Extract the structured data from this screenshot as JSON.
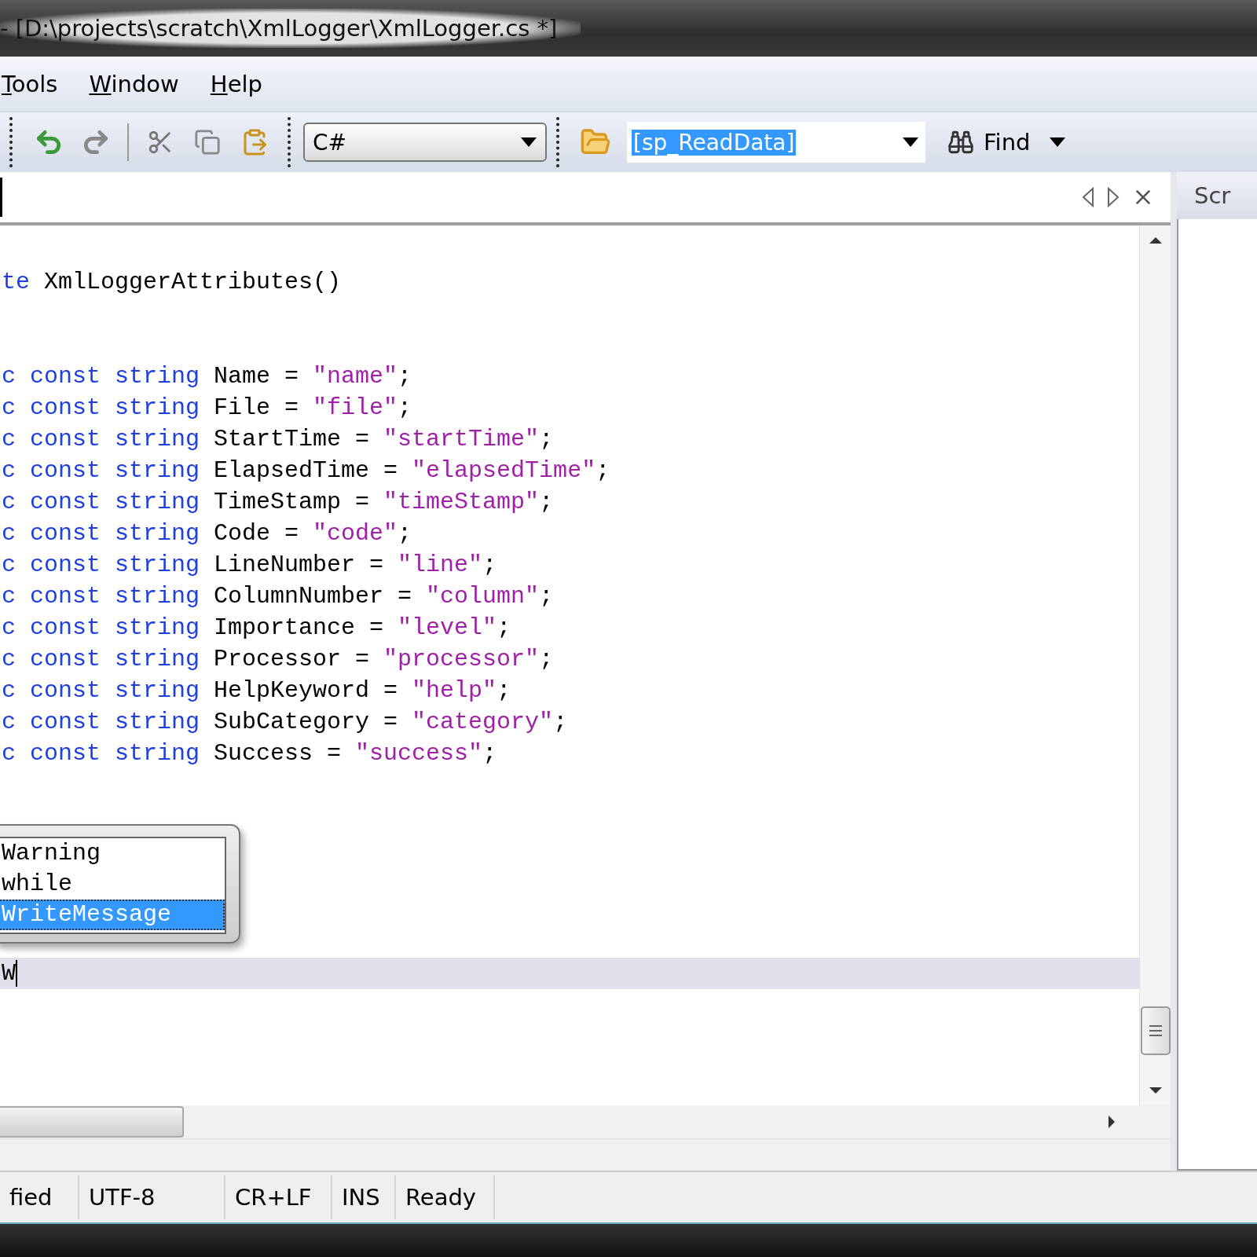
{
  "window": {
    "title": "- [D:\\projects\\scratch\\XmlLogger\\XmlLogger.cs *]"
  },
  "menu": [
    "Tools",
    "Window",
    "Help"
  ],
  "toolbar": {
    "language": "C#",
    "search": "[sp_ReadData]",
    "find_button": "Find"
  },
  "side_panel": {
    "tab": "Scr"
  },
  "editor": {
    "lines": [
      {
        "current": false,
        "tokens": [
          {
            "kind": "keyword",
            "text": "te"
          },
          {
            "kind": "plain",
            "text": " XmlLoggerAttributes()"
          }
        ]
      },
      {
        "current": false
      },
      {
        "current": false
      },
      {
        "current": false,
        "tokens": [
          {
            "kind": "keyword",
            "text": "c const string"
          },
          {
            "kind": "plain",
            "text": " Name = "
          },
          {
            "kind": "string",
            "text": "\"name\""
          },
          {
            "kind": "plain",
            "text": ";"
          }
        ]
      },
      {
        "current": false,
        "tokens": [
          {
            "kind": "keyword",
            "text": "c const string"
          },
          {
            "kind": "plain",
            "text": " File = "
          },
          {
            "kind": "string",
            "text": "\"file\""
          },
          {
            "kind": "plain",
            "text": ";"
          }
        ]
      },
      {
        "current": false,
        "tokens": [
          {
            "kind": "keyword",
            "text": "c const string"
          },
          {
            "kind": "plain",
            "text": " StartTime = "
          },
          {
            "kind": "string",
            "text": "\"startTime\""
          },
          {
            "kind": "plain",
            "text": ";"
          }
        ]
      },
      {
        "current": false,
        "tokens": [
          {
            "kind": "keyword",
            "text": "c const string"
          },
          {
            "kind": "plain",
            "text": " ElapsedTime = "
          },
          {
            "kind": "string",
            "text": "\"elapsedTime\""
          },
          {
            "kind": "plain",
            "text": ";"
          }
        ]
      },
      {
        "current": false,
        "tokens": [
          {
            "kind": "keyword",
            "text": "c const string"
          },
          {
            "kind": "plain",
            "text": " TimeStamp = "
          },
          {
            "kind": "string",
            "text": "\"timeStamp\""
          },
          {
            "kind": "plain",
            "text": ";"
          }
        ]
      },
      {
        "current": false,
        "tokens": [
          {
            "kind": "keyword",
            "text": "c const string"
          },
          {
            "kind": "plain",
            "text": " Code = "
          },
          {
            "kind": "string",
            "text": "\"code\""
          },
          {
            "kind": "plain",
            "text": ";"
          }
        ]
      },
      {
        "current": false,
        "tokens": [
          {
            "kind": "keyword",
            "text": "c const string"
          },
          {
            "kind": "plain",
            "text": " LineNumber = "
          },
          {
            "kind": "string",
            "text": "\"line\""
          },
          {
            "kind": "plain",
            "text": ";"
          }
        ]
      },
      {
        "current": false,
        "tokens": [
          {
            "kind": "keyword",
            "text": "c const string"
          },
          {
            "kind": "plain",
            "text": " ColumnNumber = "
          },
          {
            "kind": "string",
            "text": "\"column\""
          },
          {
            "kind": "plain",
            "text": ";"
          }
        ]
      },
      {
        "current": false,
        "tokens": [
          {
            "kind": "keyword",
            "text": "c const string"
          },
          {
            "kind": "plain",
            "text": " Importance = "
          },
          {
            "kind": "string",
            "text": "\"level\""
          },
          {
            "kind": "plain",
            "text": ";"
          }
        ]
      },
      {
        "current": false,
        "tokens": [
          {
            "kind": "keyword",
            "text": "c const string"
          },
          {
            "kind": "plain",
            "text": " Processor = "
          },
          {
            "kind": "string",
            "text": "\"processor\""
          },
          {
            "kind": "plain",
            "text": ";"
          }
        ]
      },
      {
        "current": false,
        "tokens": [
          {
            "kind": "keyword",
            "text": "c const string"
          },
          {
            "kind": "plain",
            "text": " HelpKeyword = "
          },
          {
            "kind": "string",
            "text": "\"help\""
          },
          {
            "kind": "plain",
            "text": ";"
          }
        ]
      },
      {
        "current": false,
        "tokens": [
          {
            "kind": "keyword",
            "text": "c const string"
          },
          {
            "kind": "plain",
            "text": " SubCategory = "
          },
          {
            "kind": "string",
            "text": "\"category\""
          },
          {
            "kind": "plain",
            "text": ";"
          }
        ]
      },
      {
        "current": false,
        "tokens": [
          {
            "kind": "keyword",
            "text": "c const string"
          },
          {
            "kind": "plain",
            "text": " Success = "
          },
          {
            "kind": "string",
            "text": "\"success\""
          },
          {
            "kind": "plain",
            "text": ";"
          }
        ]
      },
      {
        "current": false
      },
      {
        "current": false
      },
      {
        "current": false
      },
      {
        "current": false
      },
      {
        "current": false
      },
      {
        "current": false
      },
      {
        "current": true,
        "tokens": [
          {
            "kind": "plain",
            "text": "W"
          }
        ]
      }
    ]
  },
  "autocomplete": {
    "items": [
      {
        "label": "Warning",
        "selected": false
      },
      {
        "label": "while",
        "selected": false
      },
      {
        "label": "WriteMessage",
        "selected": true
      }
    ]
  },
  "status_bar": [
    "fied",
    "UTF-8",
    "CR+LF",
    "INS",
    "Ready"
  ]
}
